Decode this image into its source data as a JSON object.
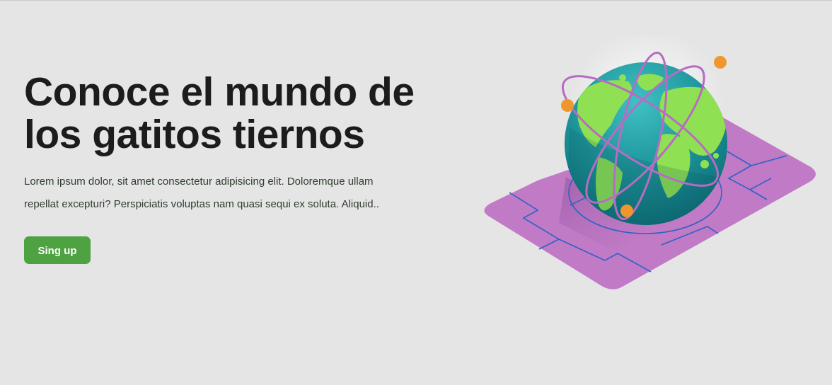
{
  "hero": {
    "title": "Conoce el mundo de los gatitos tiernos",
    "description": "Lorem ipsum dolor, sit amet consectetur adipisicing elit. Doloremque ullam repellat excepturi? Perspiciatis voluptas nam quasi sequi ex soluta. Aliquid..",
    "cta_label": "Sing up"
  },
  "illustration": {
    "icon": "globe-sim-card-illustration"
  },
  "colors": {
    "background": "#e5e5e5",
    "title": "#1c1c1c",
    "text": "#2f3d2f",
    "button": "#4ea241",
    "button_text": "#ffffff",
    "card": "#c07ac6",
    "ocean": "#1b8f8f",
    "land": "#8fe052",
    "orbit": "#b76cc4",
    "orbit_dot": "#f0962e",
    "circuit": "#2e62c4"
  }
}
